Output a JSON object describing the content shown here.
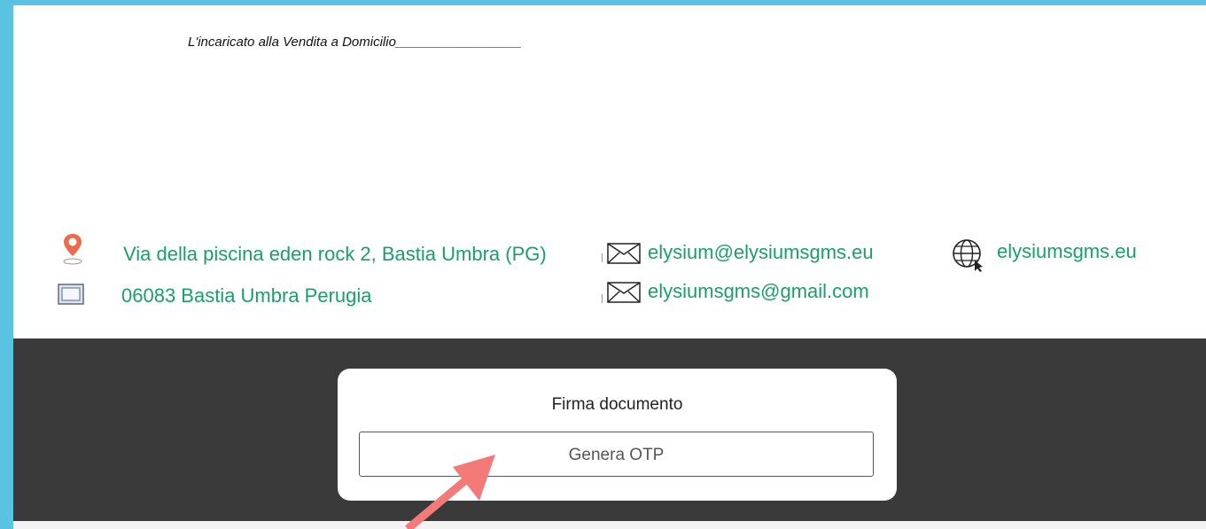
{
  "document": {
    "signature_label": "L'incaricato alla Vendita a Domicilio_________________",
    "address_line1": "Via della piscina eden rock 2, Bastia Umbra (PG)",
    "address_line2": "06083 Bastia Umbra Perugia",
    "email1": "elysium@elysiumsgms.eu",
    "email2": "elysiumsgms@gmail.com",
    "website": "elysiumsgms.eu",
    "icons": [
      "map-pin-icon",
      "frame-icon",
      "envelope-icon",
      "envelope-icon",
      "globe-icon"
    ],
    "text_color": "#18a06a"
  },
  "dialog": {
    "title": "Firma documento",
    "button_label": "Genera OTP"
  },
  "annotation": {
    "arrow_color": "#f47a7a"
  }
}
